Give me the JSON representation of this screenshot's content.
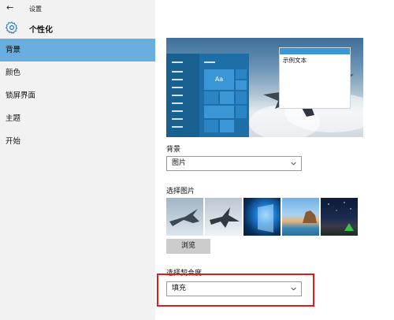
{
  "window": {
    "back_icon": "back-arrow-icon",
    "title": "设置"
  },
  "header": {
    "icon": "gear-icon",
    "title": "个性化"
  },
  "sidebar": {
    "items": [
      {
        "label": "背景",
        "active": true
      },
      {
        "label": "颜色",
        "active": false
      },
      {
        "label": "锁屏界面",
        "active": false
      },
      {
        "label": "主题",
        "active": false
      },
      {
        "label": "开始",
        "active": false
      }
    ]
  },
  "main": {
    "preview": {
      "sample_text": "示例文本",
      "tile_label": "Aa"
    },
    "background": {
      "label": "背景",
      "value": "图片"
    },
    "choose_picture": {
      "label": "选择图片",
      "browse_label": "浏览"
    },
    "fit": {
      "label": "选择契合度",
      "value": "填充"
    }
  },
  "colors": {
    "accent": "#6aaee0",
    "highlight_border": "#d91c1c",
    "tile_blue": "#1e6fa8"
  }
}
